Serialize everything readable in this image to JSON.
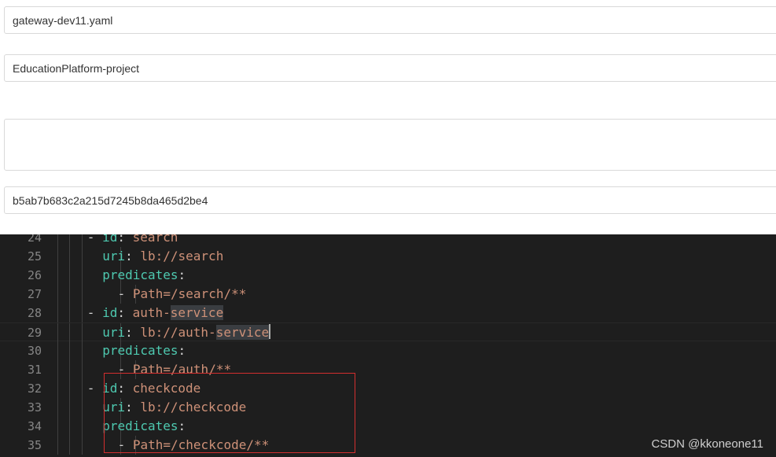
{
  "form": {
    "data_id": "gateway-dev11.yaml",
    "group": "EducationPlatform-project",
    "description": "",
    "md5": "b5ab7b683c2a215d7245b8da465d2be4"
  },
  "editor": {
    "lines": [
      {
        "num": "24",
        "indent": 2,
        "parts": [
          {
            "t": "- ",
            "c": "pun"
          },
          {
            "t": "id",
            "c": "key"
          },
          {
            "t": ": ",
            "c": "pun"
          },
          {
            "t": "search",
            "c": "str"
          }
        ]
      },
      {
        "num": "25",
        "indent": 3,
        "parts": [
          {
            "t": "uri",
            "c": "key"
          },
          {
            "t": ": ",
            "c": "pun"
          },
          {
            "t": "lb://search",
            "c": "str"
          }
        ]
      },
      {
        "num": "26",
        "indent": 3,
        "parts": [
          {
            "t": "predicates",
            "c": "key"
          },
          {
            "t": ":",
            "c": "pun"
          }
        ]
      },
      {
        "num": "27",
        "indent": 4,
        "parts": [
          {
            "t": "- ",
            "c": "pun"
          },
          {
            "t": "Path=/search/**",
            "c": "str"
          }
        ]
      },
      {
        "num": "28",
        "indent": 2,
        "parts": [
          {
            "t": "- ",
            "c": "pun"
          },
          {
            "t": "id",
            "c": "key"
          },
          {
            "t": ": ",
            "c": "pun"
          },
          {
            "t": "auth-",
            "c": "str"
          },
          {
            "t": "service",
            "c": "str hl"
          }
        ]
      },
      {
        "num": "29",
        "indent": 3,
        "current": true,
        "parts": [
          {
            "t": "uri",
            "c": "key"
          },
          {
            "t": ": ",
            "c": "pun"
          },
          {
            "t": "lb://auth-",
            "c": "str"
          },
          {
            "t": "service",
            "c": "str hl"
          }
        ],
        "cursor": true
      },
      {
        "num": "30",
        "indent": 3,
        "parts": [
          {
            "t": "predicates",
            "c": "key"
          },
          {
            "t": ":",
            "c": "pun"
          }
        ]
      },
      {
        "num": "31",
        "indent": 4,
        "parts": [
          {
            "t": "- ",
            "c": "pun"
          },
          {
            "t": "Path=/auth/**",
            "c": "str"
          }
        ]
      },
      {
        "num": "32",
        "indent": 2,
        "parts": [
          {
            "t": "- ",
            "c": "pun"
          },
          {
            "t": "id",
            "c": "key"
          },
          {
            "t": ": ",
            "c": "pun"
          },
          {
            "t": "checkcode",
            "c": "str"
          }
        ]
      },
      {
        "num": "33",
        "indent": 3,
        "parts": [
          {
            "t": "uri",
            "c": "key"
          },
          {
            "t": ": ",
            "c": "pun"
          },
          {
            "t": "lb://checkcode",
            "c": "str"
          }
        ]
      },
      {
        "num": "34",
        "indent": 3,
        "parts": [
          {
            "t": "predicates",
            "c": "key"
          },
          {
            "t": ":",
            "c": "pun"
          }
        ]
      },
      {
        "num": "35",
        "indent": 4,
        "parts": [
          {
            "t": "- ",
            "c": "pun"
          },
          {
            "t": "Path=/checkcode/**",
            "c": "str"
          }
        ]
      }
    ]
  },
  "watermark": "CSDN @kkoneone11"
}
